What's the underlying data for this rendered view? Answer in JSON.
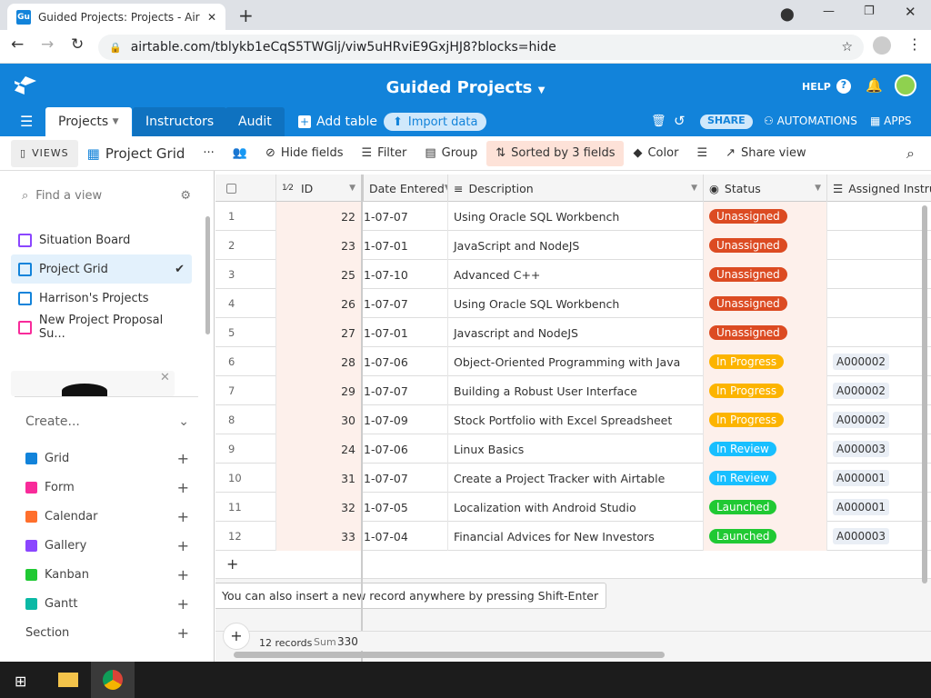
{
  "browser": {
    "tab_title": "Guided Projects: Projects - Airtab",
    "favicon": "Gu",
    "url": "airtable.com/tblykb1eCqS5TWGlj/viw5uHRviE9GxjHJ8?blocks=hide"
  },
  "header": {
    "base_title": "Guided Projects",
    "help": "HELP",
    "tabs": [
      "Projects",
      "Instructors",
      "Audit"
    ],
    "add_table": "Add table",
    "import_data": "Import data",
    "share": "SHARE",
    "automations": "AUTOMATIONS",
    "apps": "APPS"
  },
  "toolbar": {
    "views": "VIEWS",
    "view_name": "Project Grid",
    "hide_fields": "Hide fields",
    "filter": "Filter",
    "group": "Group",
    "sorted": "Sorted by 3 fields",
    "color": "Color",
    "share_view": "Share view"
  },
  "sidebar": {
    "find_placeholder": "Find a view",
    "views": [
      {
        "label": "Situation Board",
        "color": "#8b46ff"
      },
      {
        "label": "Project Grid",
        "color": "#1283da"
      },
      {
        "label": "Harrison's Projects",
        "color": "#1283da"
      },
      {
        "label": "New Project Proposal Su...",
        "color": "#f82b9a"
      }
    ],
    "create": "Create...",
    "create_items": [
      {
        "label": "Grid",
        "color": "#1283da"
      },
      {
        "label": "Form",
        "color": "#f82b9a"
      },
      {
        "label": "Calendar",
        "color": "#ff6f2c"
      },
      {
        "label": "Gallery",
        "color": "#8b46ff"
      },
      {
        "label": "Kanban",
        "color": "#20c933"
      },
      {
        "label": "Gantt",
        "color": "#0bb9a5"
      }
    ],
    "section": "Section"
  },
  "grid": {
    "columns": [
      "ID",
      "Date Entered",
      "Description",
      "Status",
      "Assigned Instru"
    ],
    "rows": [
      {
        "n": "1",
        "id": "22",
        "date": "1-07-07",
        "desc": "Using Oracle SQL Workbench",
        "status": "Unassigned",
        "assigned": ""
      },
      {
        "n": "2",
        "id": "23",
        "date": "1-07-01",
        "desc": "JavaScript and NodeJS",
        "status": "Unassigned",
        "assigned": ""
      },
      {
        "n": "3",
        "id": "25",
        "date": "1-07-10",
        "desc": "Advanced C++",
        "status": "Unassigned",
        "assigned": ""
      },
      {
        "n": "4",
        "id": "26",
        "date": "1-07-07",
        "desc": "Using Oracle SQL Workbench",
        "status": "Unassigned",
        "assigned": ""
      },
      {
        "n": "5",
        "id": "27",
        "date": "1-07-01",
        "desc": "Javascript and NodeJS",
        "status": "Unassigned",
        "assigned": ""
      },
      {
        "n": "6",
        "id": "28",
        "date": "1-07-06",
        "desc": "Object-Oriented Programming with Java",
        "status": "In Progress",
        "assigned": "A000002"
      },
      {
        "n": "7",
        "id": "29",
        "date": "1-07-07",
        "desc": "Building a Robust User Interface",
        "status": "In Progress",
        "assigned": "A000002"
      },
      {
        "n": "8",
        "id": "30",
        "date": "1-07-09",
        "desc": "Stock Portfolio with Excel Spreadsheet",
        "status": "In Progress",
        "assigned": "A000002"
      },
      {
        "n": "9",
        "id": "24",
        "date": "1-07-06",
        "desc": "Linux Basics",
        "status": "In Review",
        "assigned": "A000003"
      },
      {
        "n": "10",
        "id": "31",
        "date": "1-07-07",
        "desc": "Create a Project Tracker with Airtable",
        "status": "In Review",
        "assigned": "A000001"
      },
      {
        "n": "11",
        "id": "32",
        "date": "1-07-05",
        "desc": "Localization with Android Studio",
        "status": "Launched",
        "assigned": "A000001"
      },
      {
        "n": "12",
        "id": "33",
        "date": "1-07-04",
        "desc": "Financial Advices for New Investors",
        "status": "Launched",
        "assigned": "A000003"
      }
    ],
    "status_colors": {
      "Unassigned": "#dc4b22",
      "In Progress": "#fcb400",
      "In Review": "#18bfff",
      "Launched": "#20c933"
    },
    "tooltip": "You can also insert a new record anywhere by pressing Shift-Enter",
    "records": "12 records",
    "sum_label": "Sum",
    "sum_value": "330"
  }
}
